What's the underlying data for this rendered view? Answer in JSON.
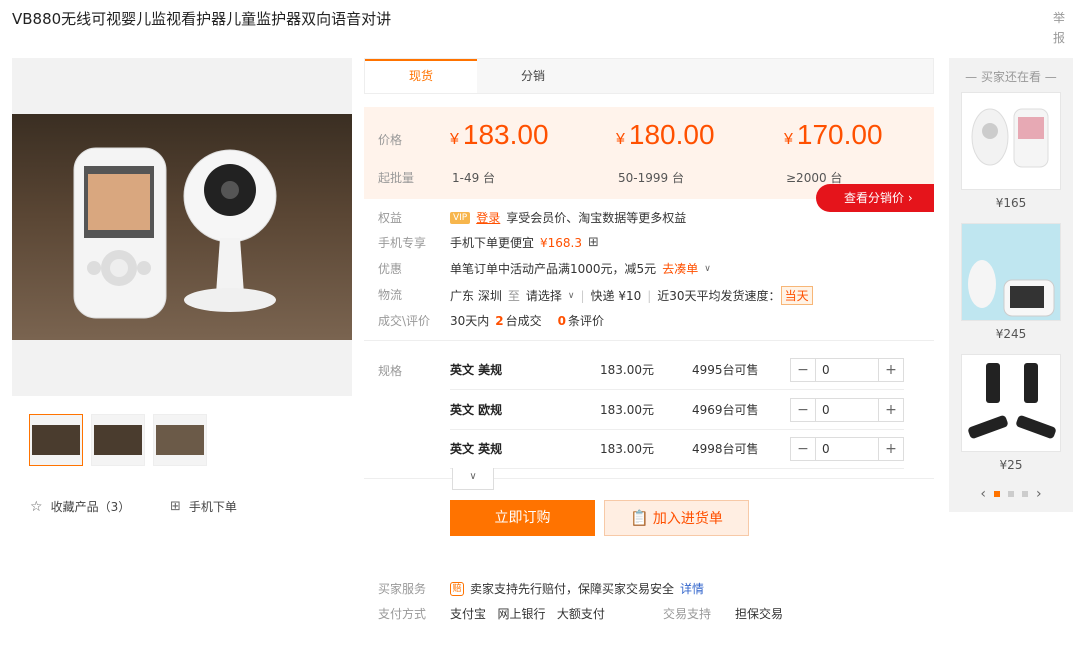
{
  "header": {
    "title": "VB880无线可视婴儿监视看护器儿童监护器双向语音对讲",
    "report": "举报"
  },
  "gallery": {
    "favorite_label": "收藏产品（3）",
    "mobile_order_label": "手机下单"
  },
  "tabs": [
    {
      "label": "现货"
    },
    {
      "label": "分销"
    }
  ],
  "pricing": {
    "price_label": "价格",
    "qty_label": "起批量",
    "currency": "¥",
    "tiers": [
      {
        "price": "183.00",
        "qty": "1-49 台"
      },
      {
        "price": "180.00",
        "qty": "50-1999 台"
      },
      {
        "price": "170.00",
        "qty": "≥2000 台"
      }
    ],
    "distribution_button": "查看分销价  ›"
  },
  "info": {
    "rights_label": "权益",
    "vip_badge": "VIP",
    "login_link": "登录",
    "rights_text": "享受会员价、淘宝数据等更多权益",
    "mobile_label": "手机专享",
    "mobile_text": "手机下单更便宜",
    "mobile_price": "¥168.3",
    "promo_label": "优惠",
    "promo_text": "单笔订单中活动产品满1000元，减5元",
    "promo_link": "去凑单",
    "logistics_label": "物流",
    "origin": "广东 深圳",
    "to": "至",
    "destination": "请选择",
    "express": "快递 ¥10",
    "ship_speed_text": "近30天平均发货速度：",
    "ship_speed_value": "当天",
    "deals_label": "成交\\评价",
    "deals_prefix": "30天内",
    "deals_count": "2",
    "deals_suffix": "台成交",
    "reviews_count": "0",
    "reviews_suffix": "条评价"
  },
  "specs": {
    "label": "规格",
    "rows": [
      {
        "name": "英文 美规",
        "price": "183.00元",
        "stock": "4995台可售",
        "qty": "0"
      },
      {
        "name": "英文 欧规",
        "price": "183.00元",
        "stock": "4969台可售",
        "qty": "0"
      },
      {
        "name": "英文 英规",
        "price": "183.00元",
        "stock": "4998台可售",
        "qty": "0"
      }
    ]
  },
  "actions": {
    "buy": "立即订购",
    "add_to_list": "加入进货单"
  },
  "services": {
    "buyer_service_label": "买家服务",
    "buyer_service_badge": "赔",
    "buyer_service_text": "卖家支持先行赔付，保障买家交易安全",
    "details_link": "详情",
    "payment_label": "支付方式",
    "payment_methods": "支付宝   网上银行   大额支付",
    "trade_support_label": "交易支持",
    "trade_support_value": "担保交易"
  },
  "side": {
    "title": "— 买家还在看 —",
    "items": [
      {
        "price": "¥165"
      },
      {
        "price": "¥245"
      },
      {
        "price": "¥25"
      }
    ]
  },
  "colors": {
    "accent": "#ff7300",
    "price": "#ff5000",
    "dist": "#e5141b"
  }
}
